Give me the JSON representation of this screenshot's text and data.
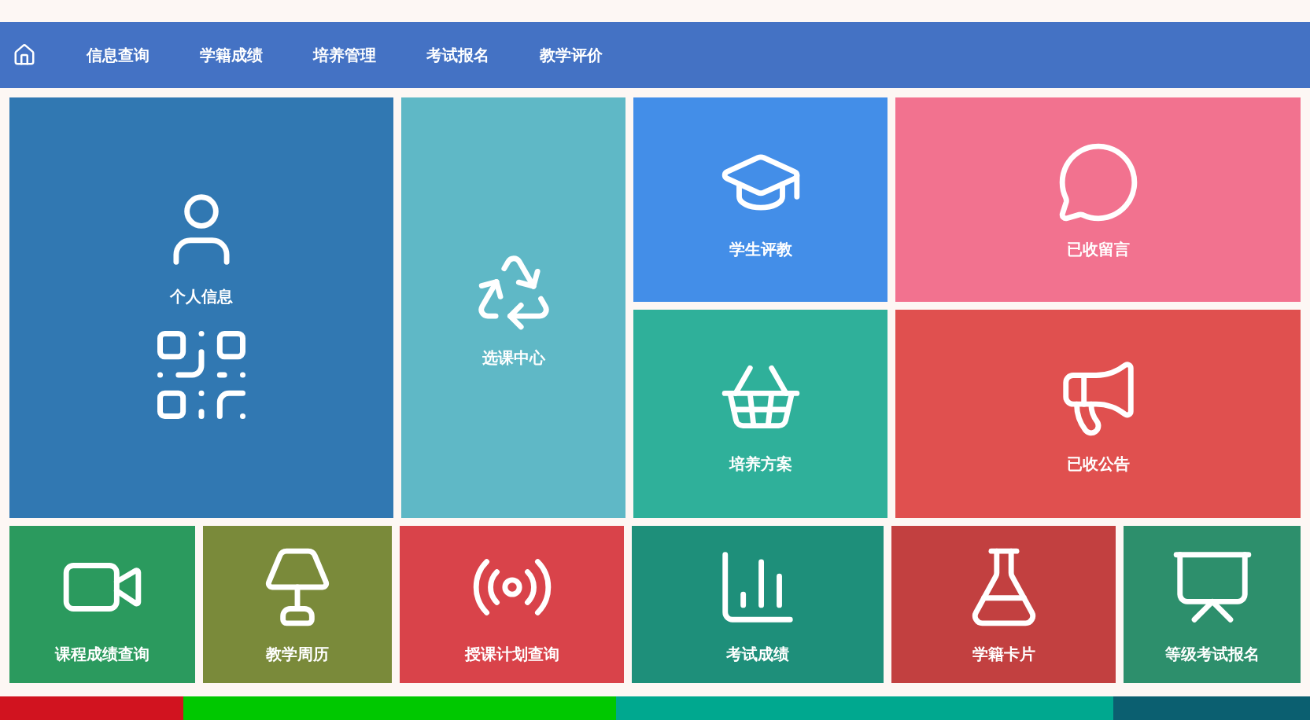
{
  "nav": {
    "items": [
      {
        "label": "信息查询"
      },
      {
        "label": "学籍成绩"
      },
      {
        "label": "培养管理"
      },
      {
        "label": "考试报名"
      },
      {
        "label": "教学评价"
      }
    ]
  },
  "top_tiles": [
    {
      "label": "个人信息",
      "color": "#3178b2"
    },
    {
      "label": "选课中心",
      "color": "#5fb8c6"
    },
    {
      "label": "学生评教",
      "color": "#438ee8"
    },
    {
      "label": "已收留言",
      "color": "#f2728f"
    },
    {
      "label": "培养方案",
      "color": "#2fb09a"
    },
    {
      "label": "已收公告",
      "color": "#e0504f"
    }
  ],
  "bottom_tiles": [
    {
      "label": "课程成绩查询",
      "color": "#2b9a5e"
    },
    {
      "label": "教学周历",
      "color": "#7a8a3a"
    },
    {
      "label": "授课计划查询",
      "color": "#d9434a"
    },
    {
      "label": "考试成绩",
      "color": "#1e8f7a"
    },
    {
      "label": "学籍卡片",
      "color": "#c24040"
    },
    {
      "label": "等级考试报名",
      "color": "#2d8f6c"
    }
  ]
}
